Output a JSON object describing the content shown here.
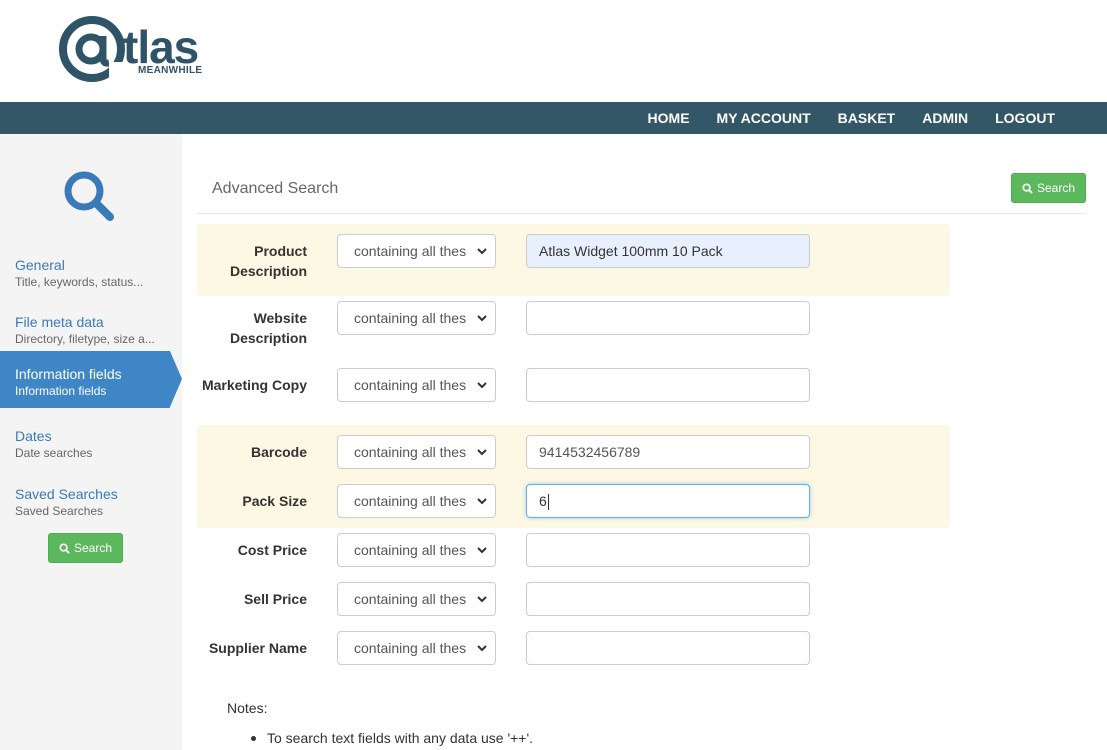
{
  "logo": {
    "brand": "tlas",
    "sub": "MEANWHILE"
  },
  "nav": [
    "HOME",
    "MY ACCOUNT",
    "BASKET",
    "ADMIN",
    "LOGOUT"
  ],
  "sidebar": {
    "items": [
      {
        "title": "General",
        "subtitle": "Title, keywords, status..."
      },
      {
        "title": "File meta data",
        "subtitle": "Directory, filetype, size a..."
      },
      {
        "title": "Information fields",
        "subtitle": "Information fields",
        "active": true
      },
      {
        "title": "Dates",
        "subtitle": "Date searches"
      },
      {
        "title": "Saved Searches",
        "subtitle": "Saved Searches"
      }
    ],
    "search_label": "Search"
  },
  "page": {
    "title": "Advanced Search",
    "search_label": "Search"
  },
  "fields": [
    {
      "label": "Product Description",
      "mode": "containing all thes",
      "value": "Atlas Widget 100mm 10 Pack"
    },
    {
      "label": "Website Description",
      "mode": "containing all thes",
      "value": ""
    },
    {
      "label": "Marketing Copy",
      "mode": "containing all thes",
      "value": ""
    },
    {
      "label": "Barcode",
      "mode": "containing all thes",
      "value": "9414532456789"
    },
    {
      "label": "Pack Size",
      "mode": "containing all thes",
      "value": "6"
    },
    {
      "label": "Cost Price",
      "mode": "containing all thes",
      "value": ""
    },
    {
      "label": "Sell Price",
      "mode": "containing all thes",
      "value": ""
    },
    {
      "label": "Supplier Name",
      "mode": "containing all thes",
      "value": ""
    }
  ],
  "notes": {
    "label": "Notes:",
    "items": [
      "To search text fields with any data use '++'."
    ]
  },
  "colors": {
    "navbar": "#335767",
    "accent": "#3f86c6",
    "highlight": "#fcf8e3",
    "button": "#5cb85c"
  }
}
